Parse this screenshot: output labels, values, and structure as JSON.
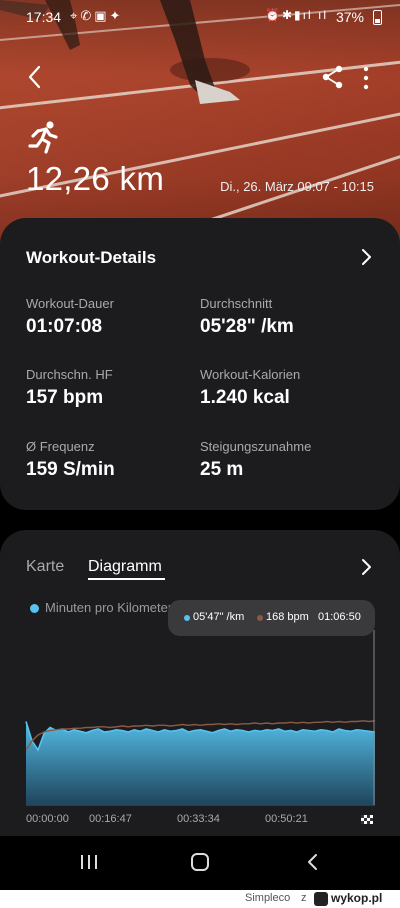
{
  "status_bar": {
    "time": "17:34",
    "battery": "37%",
    "icons_left": [
      "location-icon",
      "whatsapp-icon",
      "message-icon",
      "app-icon"
    ],
    "icons_right": [
      "alarm-icon",
      "bluetooth-icon",
      "vibrate-icon",
      "signal-icon",
      "signal-icon"
    ]
  },
  "header": {
    "distance": "12,26 km",
    "date_range": "Di., 26. März 09:07 - 10:15",
    "activity_icon": "running-icon"
  },
  "details": {
    "title": "Workout-Details",
    "items": [
      {
        "label": "Workout-Dauer",
        "value": "01:07:08"
      },
      {
        "label": "Durchschnitt",
        "value": "05'28\" /km"
      },
      {
        "label": "Durchschn. HF",
        "value": "157 bpm"
      },
      {
        "label": "Workout-Kalorien",
        "value": "1.240 kcal"
      },
      {
        "label": "Ø Frequenz",
        "value": "159 S/min"
      },
      {
        "label": "Steigungszunahme",
        "value": "25 m"
      }
    ]
  },
  "chart_card": {
    "tabs": [
      "Karte",
      "Diagramm"
    ],
    "active_tab": "Diagramm",
    "legend_label": "Minuten pro Kilometer",
    "tooltip": {
      "pace": "05'47\" /km",
      "hr": "168 bpm",
      "time": "01:06:50"
    },
    "colors": {
      "pace": "#57c3f0",
      "hr": "#8a5a45"
    }
  },
  "chart_data": {
    "type": "area",
    "x_ticks": [
      "00:00:00",
      "00:16:47",
      "00:33:34",
      "00:50:21"
    ],
    "x_range_minutes": [
      0,
      67.1
    ],
    "series": [
      {
        "name": "Minuten pro Kilometer",
        "y_relative": [
          0.98,
          0.72,
          0.6,
          0.82,
          0.9,
          0.86,
          0.88,
          0.84,
          0.87,
          0.85,
          0.83,
          0.86,
          0.88,
          0.84,
          0.85,
          0.87,
          0.86,
          0.84,
          0.87,
          0.85,
          0.88,
          0.86,
          0.84,
          0.87,
          0.85,
          0.86,
          0.88,
          0.84,
          0.86,
          0.87,
          0.85,
          0.83,
          0.86,
          0.88,
          0.85,
          0.87,
          0.86,
          0.84,
          0.86,
          0.85,
          0.87,
          0.86,
          0.88,
          0.85,
          0.86,
          0.84,
          0.87,
          0.86,
          0.85,
          0.87,
          0.86,
          0.84,
          0.88,
          0.86,
          0.85,
          0.87,
          0.86,
          0.85,
          0.84
        ]
      },
      {
        "name": "HF",
        "y_relative": [
          0.6,
          0.72,
          0.8,
          0.84,
          0.86,
          0.87,
          0.88,
          0.88,
          0.89,
          0.89,
          0.9,
          0.9,
          0.91,
          0.91,
          0.9,
          0.91,
          0.92,
          0.91,
          0.92,
          0.92,
          0.93,
          0.92,
          0.93,
          0.93,
          0.92,
          0.93,
          0.94,
          0.93,
          0.94,
          0.93,
          0.94,
          0.94,
          0.95,
          0.94,
          0.95,
          0.94,
          0.95,
          0.95,
          0.96,
          0.95,
          0.96,
          0.95,
          0.96,
          0.96,
          0.97,
          0.96,
          0.97,
          0.96,
          0.97,
          0.97,
          0.98,
          0.97,
          0.98,
          0.97,
          0.98,
          0.98,
          0.99,
          0.98,
          0.99
        ]
      }
    ]
  },
  "nav_bar": {
    "buttons": [
      "recent-apps-icon",
      "home-icon",
      "back-icon"
    ]
  },
  "watermark": {
    "user": "Simpleco",
    "z": "z",
    "site": "wykop.pl"
  }
}
